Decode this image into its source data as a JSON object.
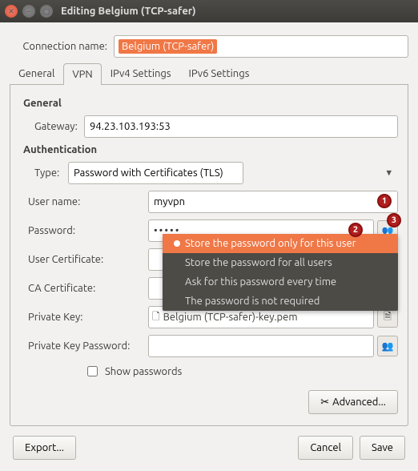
{
  "window": {
    "title": "Editing Belgium (TCP-safer)"
  },
  "connection": {
    "label": "Connection name:",
    "value": "Belgium (TCP-safer)"
  },
  "tabs": [
    "General",
    "VPN",
    "IPv4 Settings",
    "IPv6 Settings"
  ],
  "section_general": "General",
  "gateway": {
    "label": "Gateway:",
    "value": "94.23.103.193:53"
  },
  "section_auth": "Authentication",
  "type": {
    "label": "Type:",
    "value": "Password with Certificates (TLS)"
  },
  "username": {
    "label": "User name:",
    "value": "myvpn"
  },
  "password": {
    "label": "Password:",
    "value": "•••••"
  },
  "usercert": {
    "label": "User Certificate:"
  },
  "cacert": {
    "label": "CA Certificate:"
  },
  "privkey": {
    "label": "Private Key:",
    "file": "Belgium (TCP-safer)-key.pem"
  },
  "privkeypw": {
    "label": "Private Key Password:"
  },
  "showpw_label": "Show passwords",
  "advanced_label": "Advanced...",
  "menu": {
    "items": [
      "Store the password only for this user",
      "Store the password for all users",
      "Ask for this password every time",
      "The password is not required"
    ]
  },
  "footer": {
    "export": "Export...",
    "cancel": "Cancel",
    "save": "Save"
  },
  "badges": {
    "n1": "1",
    "n2": "2",
    "n3": "3"
  }
}
